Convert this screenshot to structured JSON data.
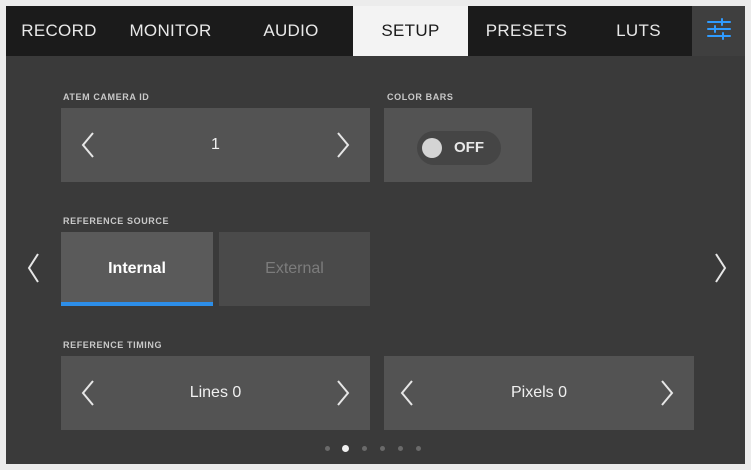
{
  "tabs": [
    {
      "label": "RECORD"
    },
    {
      "label": "MONITOR"
    },
    {
      "label": "AUDIO"
    },
    {
      "label": "SETUP"
    },
    {
      "label": "PRESETS"
    },
    {
      "label": "LUTS"
    }
  ],
  "settings_icon": "sliders-icon",
  "atem": {
    "label": "ATEM CAMERA ID",
    "value": "1"
  },
  "color_bars": {
    "label": "COLOR BARS",
    "state": "OFF"
  },
  "reference_source": {
    "label": "REFERENCE SOURCE",
    "options": [
      "Internal",
      "External"
    ],
    "selected": "Internal"
  },
  "reference_timing": {
    "label": "REFERENCE TIMING",
    "lines": "Lines 0",
    "pixels": "Pixels 0"
  },
  "pagination": {
    "pages": 6,
    "current_page": 2
  },
  "colors": {
    "accent": "#2d8ee8",
    "active_tab": "#f3f3f3"
  }
}
